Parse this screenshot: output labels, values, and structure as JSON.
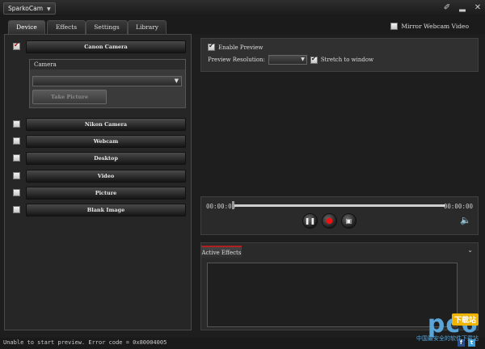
{
  "app": {
    "title": "SparkoCam"
  },
  "titlebar": {
    "icons": [
      "pin-icon",
      "minimize-icon",
      "close-icon"
    ]
  },
  "tabs": [
    {
      "label": "Device",
      "active": true
    },
    {
      "label": "Effects",
      "active": false
    },
    {
      "label": "Settings",
      "active": false
    },
    {
      "label": "Library",
      "active": false
    }
  ],
  "mirror": {
    "label": "Mirror Webcam Video",
    "checked": false
  },
  "sources": [
    {
      "label": "Canon Camera",
      "checked": true
    },
    {
      "label": "Nikon Camera",
      "checked": false
    },
    {
      "label": "Webcam",
      "checked": false
    },
    {
      "label": "Desktop",
      "checked": false
    },
    {
      "label": "Video",
      "checked": false
    },
    {
      "label": "Picture",
      "checked": false
    },
    {
      "label": "Blank Image",
      "checked": false
    }
  ],
  "camera_group": {
    "header": "Camera",
    "selected": "",
    "take_picture": "Take Picture"
  },
  "preview": {
    "enable_label": "Enable Preview",
    "enable_checked": true,
    "resolution_label": "Preview Resolution:",
    "resolution_value": "",
    "stretch_label": "Stretch to window",
    "stretch_checked": true
  },
  "player": {
    "time_start": "00:00:00",
    "time_end": "00:00:00",
    "progress": 0
  },
  "effects": {
    "tab_label": "Active Effects"
  },
  "status": {
    "text": "Unable to start preview. Error code = 0x80004005"
  },
  "watermark": {
    "logo": "pc6",
    "badge": "下载站",
    "sub": "中国最安全的软件下载站"
  },
  "colors": {
    "accent_red": "#b02020",
    "background": "#1e1e1e",
    "volume_green": "#4a9e3a"
  }
}
